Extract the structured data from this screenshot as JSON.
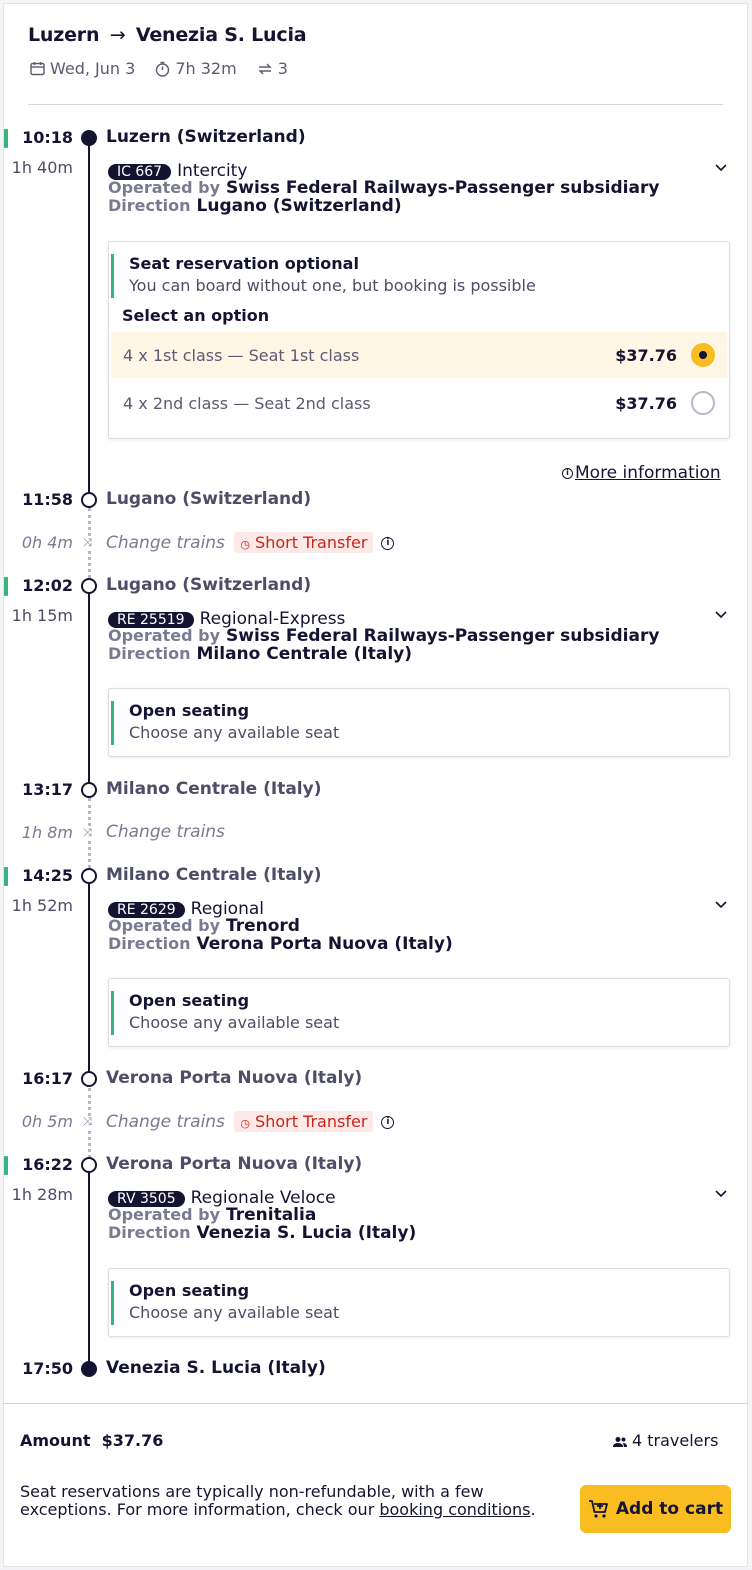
{
  "header": {
    "origin": "Luzern",
    "destination": "Venezia S. Lucia",
    "date": "Wed, Jun 3",
    "duration": "7h 32m",
    "transfers": "3"
  },
  "legs": [
    {
      "dep_time": "10:18",
      "dep_station": "Luzern (Switzerland)",
      "duration": "1h 40m",
      "badge": "IC 667",
      "train": "Intercity",
      "operated_label": "Operated by",
      "operator": "Swiss Federal Railways-Passenger subsidiary",
      "direction_label": "Direction",
      "direction": "Lugano (Switzerland)",
      "arr_time": "11:58",
      "arr_station": "Lugano (Switzerland)"
    },
    {
      "dep_time": "12:02",
      "dep_station": "Lugano (Switzerland)",
      "duration": "1h 15m",
      "badge": "RE 25519",
      "train": "Regional-Express",
      "operated_label": "Operated by",
      "operator": "Swiss Federal Railways-Passenger subsidiary",
      "direction_label": "Direction",
      "direction": "Milano Centrale (Italy)",
      "arr_time": "13:17",
      "arr_station": "Milano Centrale (Italy)"
    },
    {
      "dep_time": "14:25",
      "dep_station": "Milano Centrale (Italy)",
      "duration": "1h 52m",
      "badge": "RE 2629",
      "train": "Regional",
      "operated_label": "Operated by",
      "operator": "Trenord",
      "direction_label": "Direction",
      "direction": "Verona Porta Nuova (Italy)",
      "arr_time": "16:17",
      "arr_station": "Verona Porta Nuova (Italy)"
    },
    {
      "dep_time": "16:22",
      "dep_station": "Verona Porta Nuova (Italy)",
      "duration": "1h 28m",
      "badge": "RV 3505",
      "train": "Regionale Veloce",
      "operated_label": "Operated by",
      "operator": "Trenitalia",
      "direction_label": "Direction",
      "direction": "Venezia S. Lucia (Italy)",
      "arr_time": "17:50",
      "arr_station": "Venezia S. Lucia (Italy)"
    }
  ],
  "reservation": {
    "title": "Seat reservation optional",
    "subtitle": "You can board without one, but booking is possible",
    "select_label": "Select an option",
    "options": [
      {
        "label": "4 x 1st class — Seat 1st class",
        "price": "$37.76",
        "selected": true
      },
      {
        "label": "4 x 2nd class — Seat 2nd class",
        "price": "$37.76",
        "selected": false
      }
    ],
    "more_info": "More information"
  },
  "open_seating": {
    "title": "Open seating",
    "subtitle": "Choose any available seat"
  },
  "transfers": [
    {
      "duration": "0h 4m",
      "label": "Change trains",
      "warning": "Short Transfer"
    },
    {
      "duration": "1h 8m",
      "label": "Change trains"
    },
    {
      "duration": "0h 5m",
      "label": "Change trains",
      "warning": "Short Transfer"
    }
  ],
  "footer": {
    "amount_label": "Amount",
    "amount": "$37.76",
    "travelers": "4 travelers",
    "note_prefix": "Seat reservations are typically non-refundable, with a few exceptions. For more information, check our ",
    "note_link": "booking conditions",
    "note_suffix": ".",
    "cart_button": "Add to cart"
  },
  "colors": {
    "accent_green": "#36b37e",
    "cta_yellow": "#f9bd22",
    "warning_red": "#c8261b",
    "ink": "#141432"
  },
  "icons": [
    "arrow-right-icon",
    "calendar-icon",
    "stopwatch-icon",
    "transfer-icon",
    "chevron-down-icon",
    "info-icon",
    "clock-warning-icon",
    "change-trains-icon",
    "travelers-icon",
    "cart-icon"
  ]
}
